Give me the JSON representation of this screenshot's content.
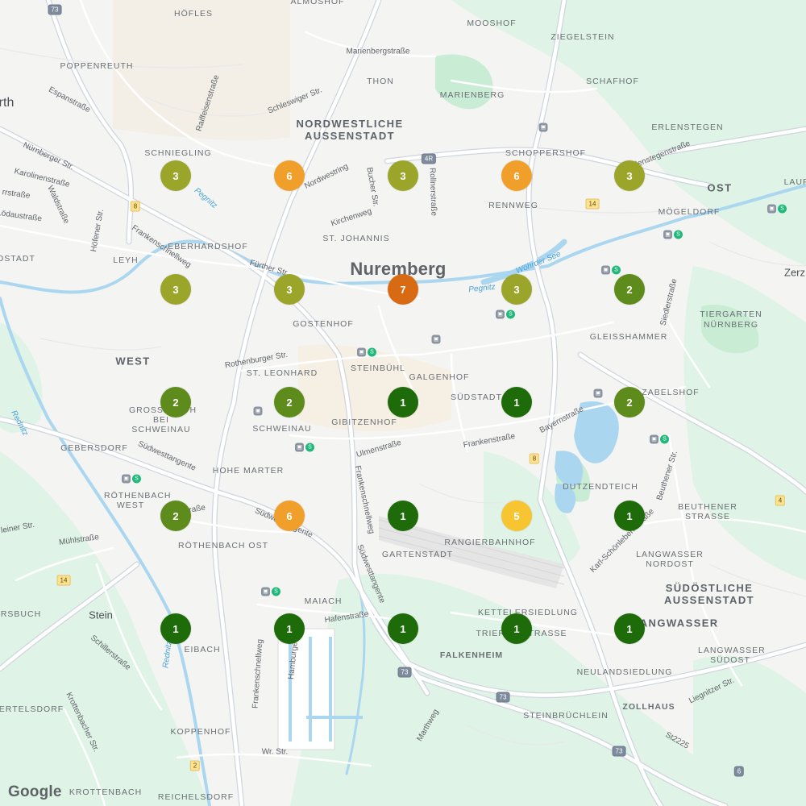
{
  "map": {
    "attribution": "Google",
    "city_label": "Nuremberg",
    "district_labels": {
      "nordwestliche": "NORDWESTLICHE AUSSENSTADT",
      "suedoestliche": "SÜDÖSTLICHE AUSSENSTADT",
      "west": "WEST",
      "ost": "OST",
      "langwasser": "LANGWASSER",
      "falkenheim": "FALKENHEIM",
      "stein": "Stein",
      "zerz": "Zerz",
      "fuerth_frag": "rth",
      "stadt_frag": "OSTADT"
    },
    "place_labels": {
      "hoefles": "HÖFLES",
      "almoshof": "ALMOSHOF",
      "mooshof": "MOOSHOF",
      "ziegelstein": "ZIEGELSTEIN",
      "poppenreuth": "POPPENREUTH",
      "thon": "THON",
      "marienberg": "MARIENBERG",
      "schafhof": "SCHAFHOF",
      "erlenstegen": "ERLENSTEGEN",
      "schniegling": "SCHNIEGLING",
      "schoppershof": "SCHOPPERSHOF",
      "rennweg": "RENNWEG",
      "moegeldorf": "MÖGELDORF",
      "eberhardshof": "EBERHARDSHOF",
      "st_johannis": "ST. JOHANNIS",
      "leyh": "LEYH",
      "gostenhof": "GOSTENHOF",
      "gleisshammer": "GLEISSHAMMER",
      "tiergarten": "TIERGARTEN NÜRNBERG",
      "st_leonhard": "ST. LEONHARD",
      "steinbuehl": "STEINBÜHL",
      "galgenhof": "GALGENHOF",
      "suedstadt": "SÜDSTADT",
      "zabelshof": "ZABELSHOF",
      "grossreuth": "GROSSREUTH BEI SCHWEINAU",
      "schweinau": "SCHWEINAU",
      "gibitzenhof": "GIBITZENHOF",
      "gebersdorf": "GEBERSDORF",
      "hohe_marter": "HOHE MARTER",
      "dutzendteich": "DUTZENDTEICH",
      "roethenbach_west": "RÖTHENBACH WEST",
      "beuthener_strasse": "BEUTHENER STRASSE",
      "rangierbahnhof": "RANGIERBAHNHOF",
      "roethenbach_ost": "RÖTHENBACH OST",
      "gartenstadt": "GARTENSTADT",
      "langwasser_nordost": "LANGWASSER NORDOST",
      "maiach": "MAIACH",
      "kettelersiedlung": "KETTELERSIEDLUNG",
      "trierer_strasse": "TRIERER STRASSE",
      "eibach": "EIBACH",
      "langwasser_suedost": "LANGWASSER SÜDOST",
      "neulandsiedlung": "NEULANDSIEDLUNG",
      "zollhaus": "ZOLLHAUS",
      "steinbruechlein": "STEINBRÜCHLEIN",
      "koppenhof": "KOPPENHOF",
      "bertelsdorf": "BERTELSDORF",
      "krottenbach": "KROTTENBACH",
      "reichelsdorf": "REICHELSDORF",
      "ersbuch": "ERSBUCH"
    },
    "street_labels": {
      "marienbergstrasse": "Marienbergstraße",
      "raiffeisenstrasse": "Raiffeisenstraße",
      "schleswiger": "Schleswiger Str.",
      "espanstrasse": "Espanstraße",
      "nuernberger": "Nürnberger Str.",
      "karolinenstrasse": "Karolinenstraße",
      "wastraße": "Waldstraße",
      "rrstrasse": "rrstraße",
      "loedaustrasse": "Lödaustraße",
      "hoefener": "Höfener Str.",
      "nordwestring": "Nordwestring",
      "bucher": "Bucher Str.",
      "rollnerstrasse": "Rollnerstraße",
      "kirchenweg": "Kirchenweg",
      "frankenschnellweg": "Frankenschnellweg",
      "fuerther": "Fürther Str.",
      "rothenburger": "Rothenburger Str.",
      "ulmenstrasse": "Ulmenstraße",
      "frankenstrasse": "Frankenstraße",
      "bayernstrasse": "Bayernstraße",
      "suedwesttangente": "Südwesttangente",
      "muehlstrasse": "Mühlstraße",
      "hafenstrasse": "Hafenstraße",
      "karl_schoenleben": "Karl-Schönleben-Straße",
      "beuthener": "Beuthener Str.",
      "siedlerstrasse": "Siedlerstraße",
      "schillerstrasse": "Schillerstraße",
      "krottenbacher": "Krottenbacher Str.",
      "hamburger": "Hamburger",
      "wr_str": "Wr. Str.",
      "marthweg": "Marthweg",
      "liegnitzer": "Liegnitzer Str.",
      "st2225": "St2225",
      "leiner": "leiner Str.",
      "nuernbergstr_frag": "uernstraße",
      "erlenstegenstrasse": "Erlenstegenstraße",
      "lauf": "LAUF"
    },
    "water_labels": {
      "pegnitz1": "Pegnitz",
      "pegnitz2": "Pegnitz",
      "woehrder": "Wöhrder See",
      "rednitz1": "Rednitz",
      "rednitz2": "Rednitz"
    },
    "shields": {
      "b73_top": "73",
      "b4r": "4R",
      "b14": "14",
      "b8_left": "8",
      "b8_mid": "8",
      "b4_right": "4",
      "b14_left": "14",
      "b73_a": "73",
      "b73_b": "73",
      "b73_c": "73",
      "b2": "2",
      "b6": "6"
    },
    "colors": {
      "dark_green": "#1e6b0a",
      "green": "#5e8c1c",
      "olive": "#9aa52a",
      "orange": "#f0a02a",
      "yellow": "#f6c531",
      "red_orange": "#d86a14"
    },
    "clusters": [
      {
        "count": "3",
        "color": "#9aa52a"
      },
      {
        "count": "6",
        "color": "#f0a02a"
      },
      {
        "count": "3",
        "color": "#9aa52a"
      },
      {
        "count": "6",
        "color": "#f0a02a"
      },
      {
        "count": "3",
        "color": "#9aa52a"
      },
      {
        "count": "3",
        "color": "#9aa52a"
      },
      {
        "count": "3",
        "color": "#9aa52a"
      },
      {
        "count": "7",
        "color": "#d86a14"
      },
      {
        "count": "3",
        "color": "#9aa52a"
      },
      {
        "count": "2",
        "color": "#5e8c1c"
      },
      {
        "count": "2",
        "color": "#5e8c1c"
      },
      {
        "count": "2",
        "color": "#5e8c1c"
      },
      {
        "count": "1",
        "color": "#1e6b0a"
      },
      {
        "count": "1",
        "color": "#1e6b0a"
      },
      {
        "count": "2",
        "color": "#5e8c1c"
      },
      {
        "count": "2",
        "color": "#5e8c1c"
      },
      {
        "count": "6",
        "color": "#f0a02a"
      },
      {
        "count": "1",
        "color": "#1e6b0a"
      },
      {
        "count": "5",
        "color": "#f6c531"
      },
      {
        "count": "1",
        "color": "#1e6b0a"
      },
      {
        "count": "1",
        "color": "#1e6b0a"
      },
      {
        "count": "1",
        "color": "#1e6b0a"
      },
      {
        "count": "1",
        "color": "#1e6b0a"
      },
      {
        "count": "1",
        "color": "#1e6b0a"
      },
      {
        "count": "1",
        "color": "#1e6b0a"
      }
    ]
  }
}
